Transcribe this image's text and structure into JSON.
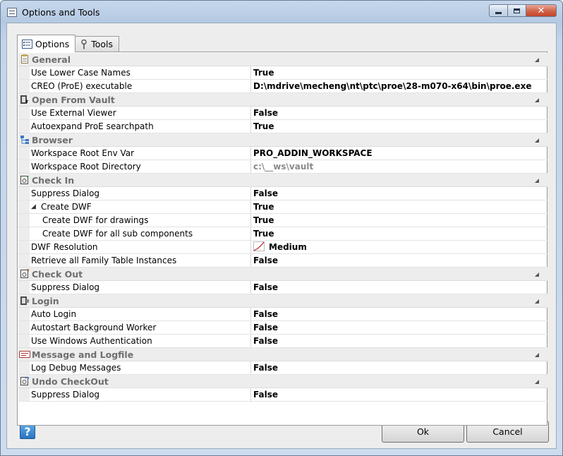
{
  "window": {
    "title": "Options and Tools",
    "close_glyph": "✕"
  },
  "tabs": [
    {
      "label": "Options",
      "icon": "options-list-icon",
      "active": true
    },
    {
      "label": "Tools",
      "icon": "wrench-icon",
      "active": false
    }
  ],
  "grid": {
    "categories": [
      {
        "label": "General",
        "icon": "general-icon",
        "rows": [
          {
            "name": "Use Lower Case Names",
            "value": "True"
          },
          {
            "name": "CREO (ProE) executable",
            "value": "D:\\mdrive\\mecheng\\nt\\ptc\\proe\\28-m070-x64\\bin\\proe.exe"
          }
        ]
      },
      {
        "label": "Open From Vault",
        "icon": "open-from-vault-icon",
        "rows": [
          {
            "name": "Use External Viewer",
            "value": "False"
          },
          {
            "name": "Autoexpand ProE searchpath",
            "value": "True"
          }
        ]
      },
      {
        "label": "Browser",
        "icon": "browser-icon",
        "rows": [
          {
            "name": "Workspace Root Env Var",
            "value": "PRO_ADDIN_WORKSPACE"
          },
          {
            "name": "Workspace Root Directory",
            "value": "c:\\__ws\\vault",
            "dim": true
          }
        ]
      },
      {
        "label": "Check In",
        "icon": "check-in-icon",
        "rows": [
          {
            "name": "Suppress Dialog",
            "value": "False"
          },
          {
            "name": "Create DWF",
            "value": "True",
            "expander": "◢"
          },
          {
            "name": "Create DWF for drawings",
            "value": "True",
            "sub": true
          },
          {
            "name": "Create DWF for all sub components",
            "value": "True",
            "sub": true
          },
          {
            "name": "DWF Resolution",
            "value": "Medium",
            "icon": "resolution-icon"
          },
          {
            "name": "Retrieve all Family Table Instances",
            "value": "False"
          }
        ]
      },
      {
        "label": "Check Out",
        "icon": "check-out-icon",
        "rows": [
          {
            "name": "Suppress Dialog",
            "value": "False"
          }
        ]
      },
      {
        "label": "Login",
        "icon": "login-icon",
        "rows": [
          {
            "name": "Auto Login",
            "value": "False"
          },
          {
            "name": "Autostart Background Worker",
            "value": "False"
          },
          {
            "name": "Use Windows Authentication",
            "value": "False"
          }
        ]
      },
      {
        "label": "Message and Logfile",
        "icon": "logfile-icon",
        "rows": [
          {
            "name": "Log Debug Messages",
            "value": "False"
          }
        ]
      },
      {
        "label": "Undo CheckOut",
        "icon": "undo-checkout-icon",
        "rows": [
          {
            "name": "Suppress Dialog",
            "value": "False"
          }
        ]
      }
    ]
  },
  "footer": {
    "help_glyph": "?",
    "ok_label": "Ok",
    "cancel_label": "Cancel"
  },
  "colors": {
    "category_label": "#6e6e6e",
    "dim_value": "#8a8a8a",
    "help_blue": "#2a74c0"
  }
}
